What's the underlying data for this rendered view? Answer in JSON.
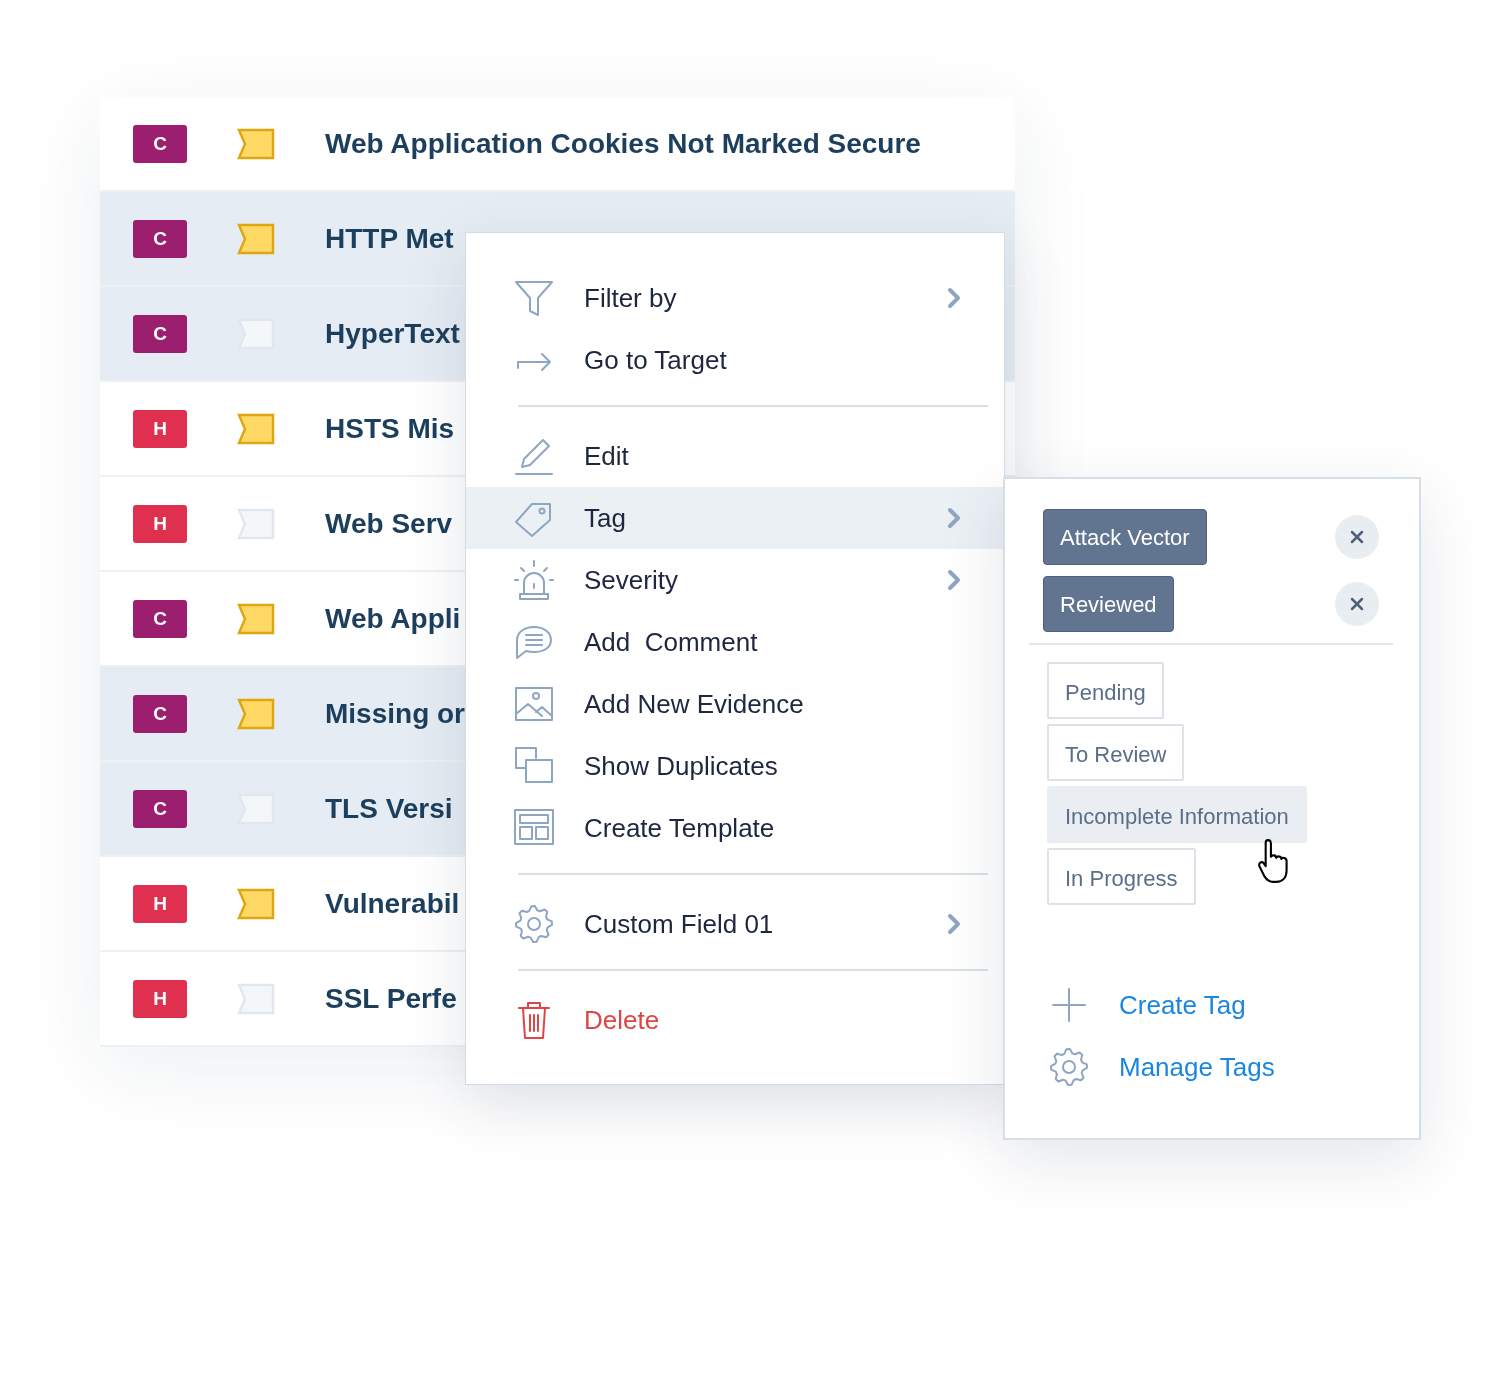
{
  "findings": [
    {
      "severity": "C",
      "color": "#9b1f6e",
      "flagged": true,
      "selected": false,
      "title": "Web Application Cookies Not Marked Secure"
    },
    {
      "severity": "C",
      "color": "#9b1f6e",
      "flagged": true,
      "selected": true,
      "title": "HTTP Met"
    },
    {
      "severity": "C",
      "color": "#9b1f6e",
      "flagged": false,
      "selected": true,
      "title": "HyperText"
    },
    {
      "severity": "H",
      "color": "#e0304f",
      "flagged": true,
      "selected": false,
      "title": "HSTS Mis"
    },
    {
      "severity": "H",
      "color": "#e0304f",
      "flagged": false,
      "selected": false,
      "title": "Web Serv"
    },
    {
      "severity": "C",
      "color": "#9b1f6e",
      "flagged": true,
      "selected": false,
      "title": "Web Appli"
    },
    {
      "severity": "C",
      "color": "#9b1f6e",
      "flagged": true,
      "selected": true,
      "title": "Missing or"
    },
    {
      "severity": "C",
      "color": "#9b1f6e",
      "flagged": false,
      "selected": true,
      "title": "TLS Versi"
    },
    {
      "severity": "H",
      "color": "#e0304f",
      "flagged": true,
      "selected": false,
      "title": "Vulnerabil"
    },
    {
      "severity": "H",
      "color": "#e0304f",
      "flagged": false,
      "selected": false,
      "title": "SSL Perfe"
    }
  ],
  "context_menu": {
    "sections": [
      {
        "items": [
          {
            "label": "Filter by",
            "submenu": true,
            "highlighted": false,
            "danger": false
          },
          {
            "label": "Go to Target",
            "submenu": false,
            "highlighted": false,
            "danger": false
          }
        ]
      },
      {
        "items": [
          {
            "label": "Edit",
            "submenu": false,
            "highlighted": false,
            "danger": false
          },
          {
            "label": "Tag",
            "submenu": true,
            "highlighted": true,
            "danger": false
          },
          {
            "label": "Severity",
            "submenu": true,
            "highlighted": false,
            "danger": false
          },
          {
            "label": "Add  Comment",
            "submenu": false,
            "highlighted": false,
            "danger": false
          },
          {
            "label": "Add New Evidence",
            "submenu": false,
            "highlighted": false,
            "danger": false
          },
          {
            "label": "Show Duplicates",
            "submenu": false,
            "highlighted": false,
            "danger": false
          },
          {
            "label": "Create Template",
            "submenu": false,
            "highlighted": false,
            "danger": false
          }
        ]
      },
      {
        "items": [
          {
            "label": "Custom Field 01",
            "submenu": true,
            "highlighted": false,
            "danger": false
          }
        ]
      },
      {
        "items": [
          {
            "label": "Delete",
            "submenu": false,
            "highlighted": false,
            "danger": true
          }
        ]
      }
    ]
  },
  "tag_menu": {
    "applied_tags": [
      {
        "label": "Attack Vector"
      },
      {
        "label": "Reviewed"
      }
    ],
    "available_tags": [
      {
        "label": "Pending",
        "selected": false
      },
      {
        "label": "To Review",
        "selected": false
      },
      {
        "label": "Incomplete Information",
        "selected": true
      },
      {
        "label": "In Progress",
        "selected": false
      }
    ],
    "actions": [
      {
        "label": "Create Tag"
      },
      {
        "label": "Manage Tags"
      }
    ]
  }
}
